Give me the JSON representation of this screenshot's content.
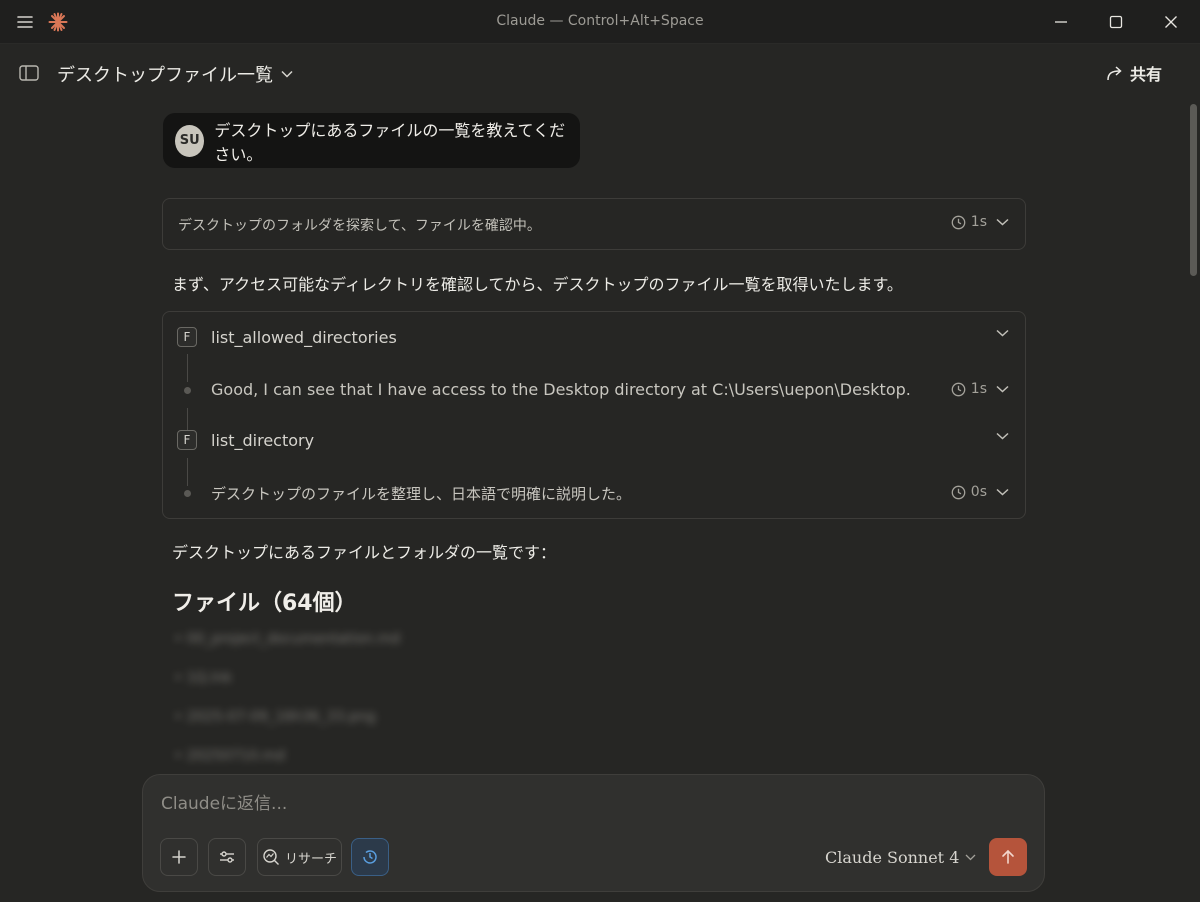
{
  "window": {
    "title": "Claude — Control+Alt+Space"
  },
  "header": {
    "conversation_title": "デスクトップファイル一覧",
    "share_label": "共有"
  },
  "user_message": {
    "avatar_initials": "SU",
    "text": "デスクトップにあるファイルの一覧を教えてください。"
  },
  "thinking": {
    "text": "デスクトップのフォルダを探索して、ファイルを確認中。",
    "duration": "1s"
  },
  "assistant": {
    "intro": "まず、アクセス可能なディレクトリを確認してから、デスクトップのファイル一覧を取得いたします。",
    "tool_steps": [
      {
        "badge": "F",
        "name": "list_allowed_directories"
      },
      {
        "text": "Good, I can see that I have access to the Desktop directory at C:\\Users\\uepon\\Desktop.",
        "duration": "1s"
      },
      {
        "badge": "F",
        "name": "list_directory"
      },
      {
        "text": "デスクトップのファイルを整理し、日本語で明確に説明した。",
        "duration": "0s"
      }
    ],
    "summary": "デスクトップにあるファイルとフォルダの一覧です：",
    "files_heading": "ファイル（64個）",
    "file_items": [
      "00_project_documentation.md",
      "1Q.lnk",
      "2025-07-09_16h36_33.png",
      "20250710.md"
    ]
  },
  "composer": {
    "placeholder": "Claudeに返信...",
    "research_label": "リサーチ",
    "model_name": "Claude Sonnet 4"
  },
  "colors": {
    "accent": "#d97757",
    "send_button": "#b5543b",
    "background": "#262624",
    "clock_active": "#5a9fe0"
  }
}
